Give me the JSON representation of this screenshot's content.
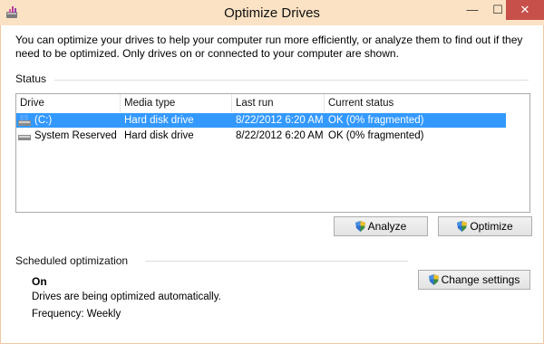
{
  "window": {
    "title": "Optimize Drives",
    "min_glyph": "—",
    "max_glyph": "☐",
    "close_glyph": "✕"
  },
  "description": "You can optimize your drives to help your computer run more efficiently, or analyze them to find out if they need to be optimized. Only drives on or connected to your computer are shown.",
  "status": {
    "label": "Status",
    "columns": [
      "Drive",
      "Media type",
      "Last run",
      "Current status"
    ],
    "rows": [
      {
        "drive": "(C:)",
        "media": "Hard disk drive",
        "last_run": "8/22/2012 6:20 AM",
        "status": "OK (0% fragmented)",
        "selected": true,
        "icon": "windows-drive-icon"
      },
      {
        "drive": "System Reserved",
        "media": "Hard disk drive",
        "last_run": "8/22/2012 6:20 AM",
        "status": "OK (0% fragmented)",
        "selected": false,
        "icon": "drive-icon"
      }
    ]
  },
  "buttons": {
    "analyze": "Analyze",
    "optimize": "Optimize",
    "change_settings": "Change settings"
  },
  "scheduled": {
    "label": "Scheduled optimization",
    "state": "On",
    "detail": "Drives are being optimized automatically.",
    "frequency": "Frequency: Weekly"
  },
  "colors": {
    "titlebar": "#fbe2c4",
    "selection": "#3399ff",
    "close_button": "#c7504a"
  }
}
